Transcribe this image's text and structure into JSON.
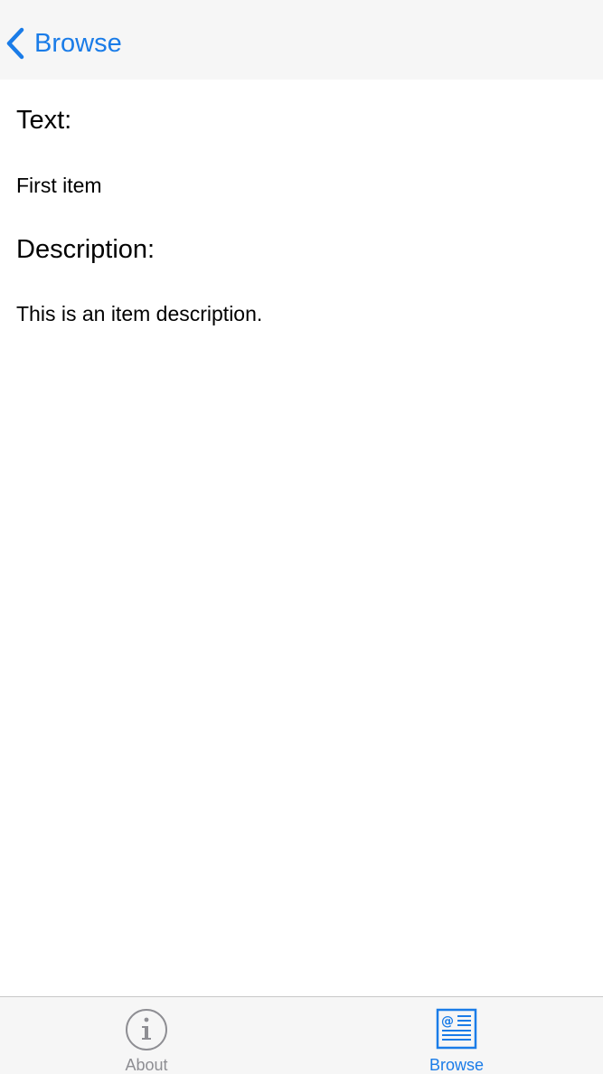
{
  "nav": {
    "back_label": "Browse"
  },
  "item": {
    "text_heading": "Text:",
    "text_value": "First item",
    "description_heading": "Description:",
    "description_value": "This is an item description."
  },
  "tabs": [
    {
      "label": "About",
      "icon": "info-icon",
      "selected": false
    },
    {
      "label": "Browse",
      "icon": "browse-icon",
      "selected": true
    }
  ],
  "colors": {
    "accent": "#1a7ce8",
    "inactive": "#8e8e93",
    "bar_background": "#f6f6f6"
  }
}
